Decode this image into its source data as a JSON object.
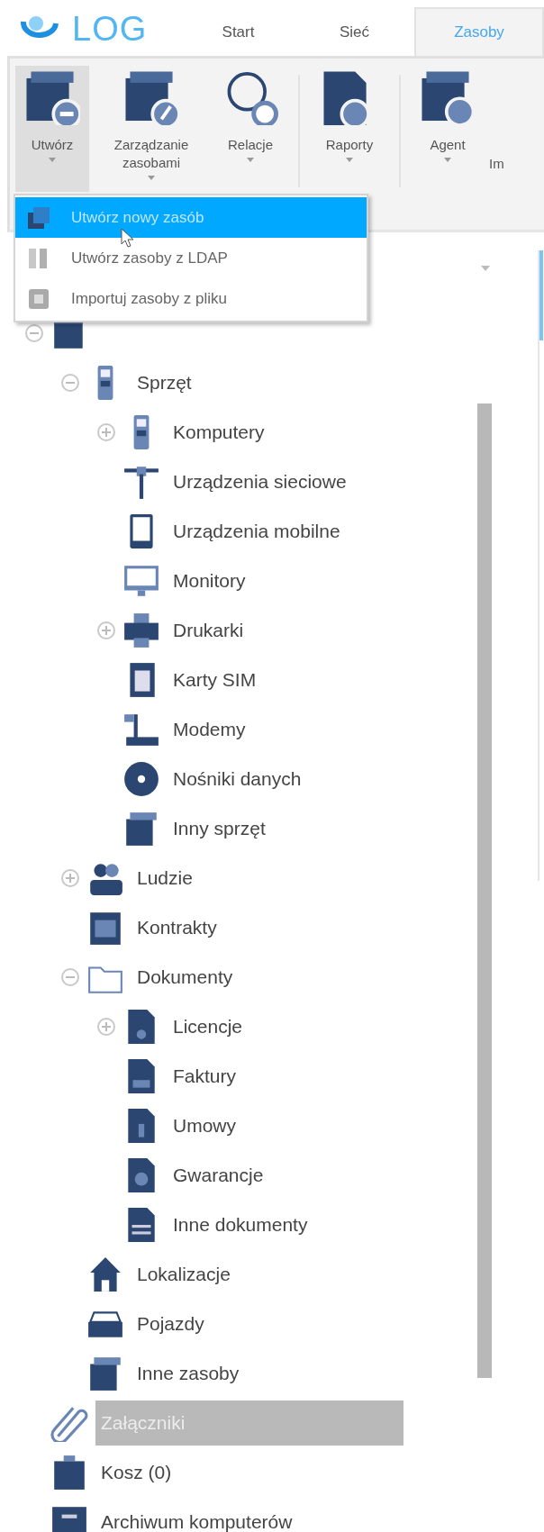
{
  "logo": "LOG",
  "tabs": [
    {
      "label": "Start",
      "selected": false
    },
    {
      "label": "Sieć",
      "selected": false
    },
    {
      "label": "Zasoby",
      "selected": true
    }
  ],
  "ribbon": [
    {
      "label": "Utwórz",
      "pressed": true
    },
    {
      "label": "Zarządzanie zasobami",
      "pressed": false
    },
    {
      "label": "Relacje",
      "pressed": false
    },
    {
      "label": "Raporty",
      "pressed": false
    },
    {
      "label": "Agent",
      "pressed": false
    }
  ],
  "ribbon_cut_label": "Im",
  "menu": [
    {
      "label": "Utwórz nowy zasób",
      "selected": true
    },
    {
      "label": "Utwórz zasoby z LDAP",
      "selected": false
    },
    {
      "label": "Importuj zasoby z pliku",
      "selected": false
    }
  ],
  "tree": [
    {
      "expanded": true,
      "children": [
        {
          "label": "Sprzęt",
          "selected": false,
          "expanded": true,
          "children": [
            {
              "label": "Komputery",
              "selected": false,
              "expanded": false
            },
            {
              "label": "Urządzenia sieciowe",
              "selected": false
            },
            {
              "label": "Urządzenia mobilne",
              "selected": false
            },
            {
              "label": "Monitory",
              "selected": false
            },
            {
              "label": "Drukarki",
              "selected": false,
              "expanded": false
            },
            {
              "label": "Karty SIM",
              "selected": false
            },
            {
              "label": "Modemy",
              "selected": false
            },
            {
              "label": "Nośniki danych",
              "selected": false
            },
            {
              "label": "Inny sprzęt",
              "selected": false
            }
          ]
        },
        {
          "label": "Ludzie",
          "selected": false,
          "expanded": false
        },
        {
          "label": "Kontrakty",
          "selected": false
        },
        {
          "label": "Dokumenty",
          "selected": false,
          "expanded": true,
          "children": [
            {
              "label": "Licencje",
              "selected": false,
              "expanded": false
            },
            {
              "label": "Faktury",
              "selected": false
            },
            {
              "label": "Umowy",
              "selected": false
            },
            {
              "label": "Gwarancje",
              "selected": false
            },
            {
              "label": "Inne dokumenty",
              "selected": false
            }
          ]
        },
        {
          "label": "Lokalizacje",
          "selected": false
        },
        {
          "label": "Pojazdy",
          "selected": false
        },
        {
          "label": "Inne zasoby",
          "selected": false
        }
      ]
    },
    {
      "label": "Załączniki",
      "selected": true
    },
    {
      "label": "Kosz (0)",
      "selected": false
    },
    {
      "label": "Archiwum komputerów",
      "selected": false
    }
  ]
}
